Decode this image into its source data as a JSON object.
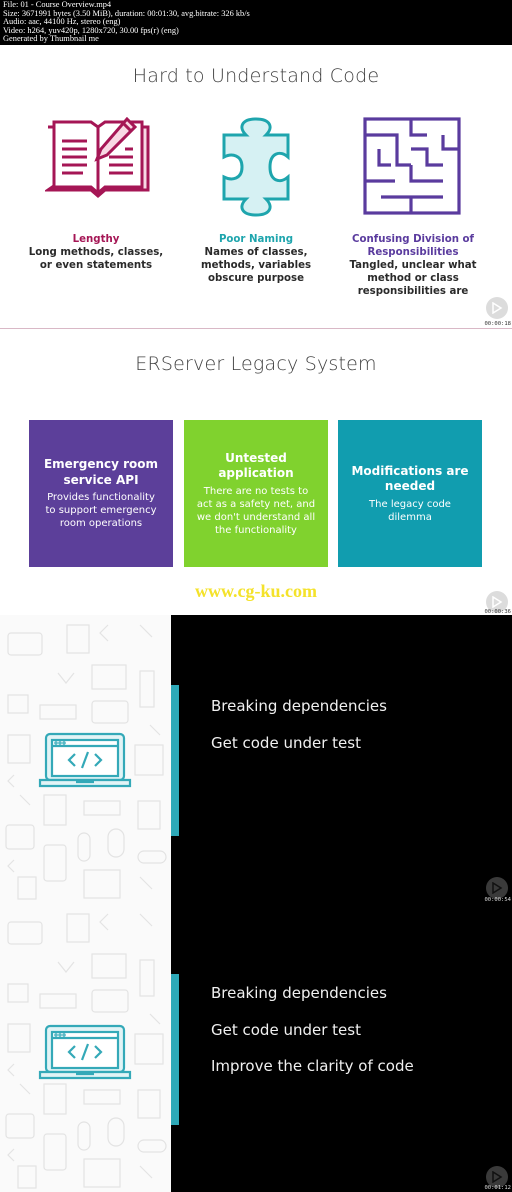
{
  "file_info": {
    "line1": "File: 01 - Course Overview.mp4",
    "line2": "Size: 3671991 bytes (3.50 MiB), duration: 00:01:30, avg.bitrate: 326 kb/s",
    "line3": "Audio: aac, 44100 Hz, stereo (eng)",
    "line4": "Video: h264, yuv420p, 1280x720, 30.00 fps(r) (eng)",
    "line5": "Generated by Thumbnail me"
  },
  "frames": [
    {
      "title": "Hard to Understand Code",
      "timestamp": "00:00:18",
      "columns": [
        {
          "icon": "open-book-pencil-icon",
          "title": "Lengthy",
          "desc_lines": [
            "Long methods, classes,",
            "or even statements"
          ],
          "color": "#a51655"
        },
        {
          "icon": "puzzle-piece-icon",
          "title": "Poor Naming",
          "desc_lines": [
            "Names of classes,",
            "methods, variables",
            "obscure purpose"
          ],
          "color": "#1ea5ad"
        },
        {
          "icon": "maze-icon",
          "title_lines": [
            "Confusing Division of",
            "Responsibilities"
          ],
          "desc_lines": [
            "Tangled, unclear what",
            "method or class",
            "responsibilities are"
          ],
          "color": "#5a3b9e"
        }
      ]
    },
    {
      "title": "ERServer Legacy System",
      "timestamp": "00:00:36",
      "watermark": "www.cg-ku.com",
      "cards": [
        {
          "title_lines": [
            "Emergency room",
            "service API"
          ],
          "desc_lines": [
            "Provides functionality",
            "to support emergency",
            "room operations"
          ],
          "color": "#5c3f9a"
        },
        {
          "title_lines": [
            "Untested",
            "application"
          ],
          "desc_lines": [
            "There are no tests to",
            "act as a safety net, and",
            "we don't understand all",
            "the functionality"
          ],
          "color": "#80d22e"
        },
        {
          "title_lines": [
            "Modifications are",
            "needed"
          ],
          "desc_lines": [
            "The legacy code",
            "dilemma"
          ],
          "color": "#119daf"
        }
      ]
    },
    {
      "timestamp": "00:00:54",
      "bullets": [
        "Breaking dependencies",
        "Get code under test"
      ]
    },
    {
      "timestamp": "00:01:12",
      "bullets": [
        "Breaking dependencies",
        "Get code under test",
        "Improve the clarity of code"
      ]
    }
  ]
}
